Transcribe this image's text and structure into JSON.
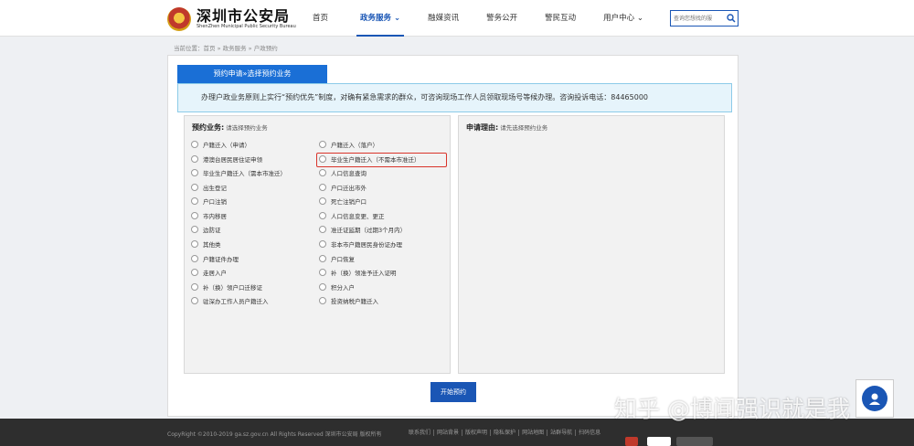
{
  "header": {
    "logo_cn": "深圳市公安局",
    "logo_en": "ShenZhen Municipal Public Security Bureau",
    "nav": [
      {
        "label": "首页"
      },
      {
        "label": "政务服务",
        "active": true
      },
      {
        "label": "融媒资讯"
      },
      {
        "label": "警务公开"
      },
      {
        "label": "警民互动"
      },
      {
        "label": "用户中心"
      }
    ],
    "search_placeholder": "查询您想找的服"
  },
  "breadcrumb": "当前位置：首页 » 政务服务 » 户政预约",
  "tab_label": "预约申请»选择预约业务",
  "notice": "办理户政业务原则上实行“预约优先”制度，对确有紧急需求的群众，可咨询现场工作人员领取现场号等候办理。咨询投诉电话：84465000",
  "left_box": {
    "title": "预约业务:",
    "subtitle": "请选择预约业务",
    "options_col1": [
      "户籍迁入（申请）",
      "港澳台居民居住证申领",
      "毕业生户籍迁入（需本市准迁）",
      "出生登记",
      "户口注销",
      "市内移居",
      "边防证",
      "其他类",
      "户籍证件办理",
      "走居入户",
      "补（换）领户口迁移证",
      "驻深办工作人员户籍迁入"
    ],
    "options_col2": [
      "户籍迁入（落户）",
      "毕业生户籍迁入（不需本市准迁）",
      "人口信息查询",
      "户口迁出市外",
      "死亡注销户口",
      "人口信息变更、更正",
      "准迁证延期（过期3个月内）",
      "非本市户籍居民身份证办理",
      "户口恢复",
      "补（换）领准予迁入证明",
      "积分入户",
      "投资纳税户籍迁入"
    ]
  },
  "right_box": {
    "title": "申请理由:",
    "subtitle": "请先选择预约业务"
  },
  "start_button": "开始预约",
  "footer": {
    "copyright": "CopyRight ©2010-2019 ga.sz.gov.cn All Rights Reserved 深圳市公安局 版权所有",
    "links": [
      "联系我们",
      "网站背景",
      "版权声明",
      "隐私保护",
      "网站地图",
      "站群导航",
      "扫码信息"
    ]
  },
  "watermark": "知乎 @博闻强识就是我",
  "colors": {
    "primary": "#1a56b5",
    "tab_blue": "#1a6fd6",
    "highlight_red": "#d9342b",
    "notice_bg": "#e6f4fb"
  }
}
